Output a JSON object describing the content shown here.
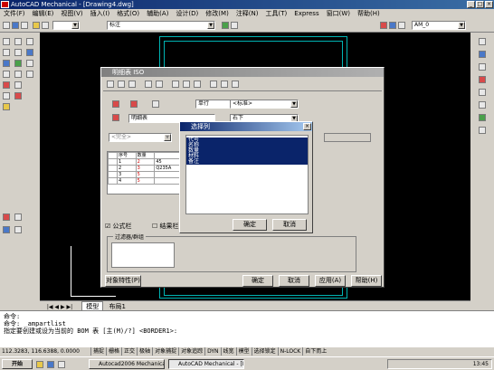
{
  "app": {
    "title": "AutoCAD Mechanical - [Drawing4.dwg]"
  },
  "menu": [
    "文件(F)",
    "编辑(E)",
    "视图(V)",
    "插入(I)",
    "格式(O)",
    "辅助(A)",
    "设计(D)",
    "修改(M)",
    "注释(N)",
    "工具(T)",
    "Express",
    "窗口(W)",
    "帮助(H)"
  ],
  "toolbar": {
    "layer_name": "标注",
    "layer2": "AM_0"
  },
  "bom_dialog": {
    "title": "明细表 ISO",
    "row_combo": "单行",
    "std_combo": "<标准>",
    "name_field": "明细表",
    "align_combo": "右下",
    "filter_combo": "<完全>",
    "columns": [
      "序号",
      "数量"
    ],
    "rows": [
      [
        "1",
        "2",
        "45"
      ],
      [
        "2",
        "3",
        "Q235A"
      ],
      [
        "3",
        "5",
        ""
      ],
      [
        "4",
        "5",
        ""
      ]
    ],
    "formula_check": "公式栏",
    "result_check": "结果栏",
    "filter_group": "过滤器/群组",
    "props_button": "对象特性(P)",
    "ok_button": "确定",
    "cancel_button": "取消",
    "apply_button": "应用(A)",
    "help_button": "帮助(H)"
  },
  "select_dialog": {
    "title": "选择列",
    "items": [
      "代号",
      "名称",
      "数量",
      "材料",
      "备注"
    ],
    "ok_button": "确定",
    "cancel_button": "取消"
  },
  "tabs": [
    "模型",
    "布局1"
  ],
  "command_lines": [
    "命令:",
    "命令: _ampartlist",
    "指定要创建或设为当前的 BOM 表 [主(M)/?] <BORDER1>:"
  ],
  "status": {
    "coords": "112.3283, 116.6388, 0.0000",
    "items": [
      "捕捉",
      "栅格",
      "正交",
      "极轴",
      "对象捕捉",
      "对象追踪",
      "DYN",
      "线宽",
      "模型",
      "选择锁定",
      "N-LOCK",
      "自下而上"
    ]
  },
  "taskbar": {
    "start": "开始",
    "tasks": [
      "Autocad2006 Mechanical...",
      "AutoCAD Mechanical - [Dr..."
    ],
    "clock": "13:45"
  }
}
